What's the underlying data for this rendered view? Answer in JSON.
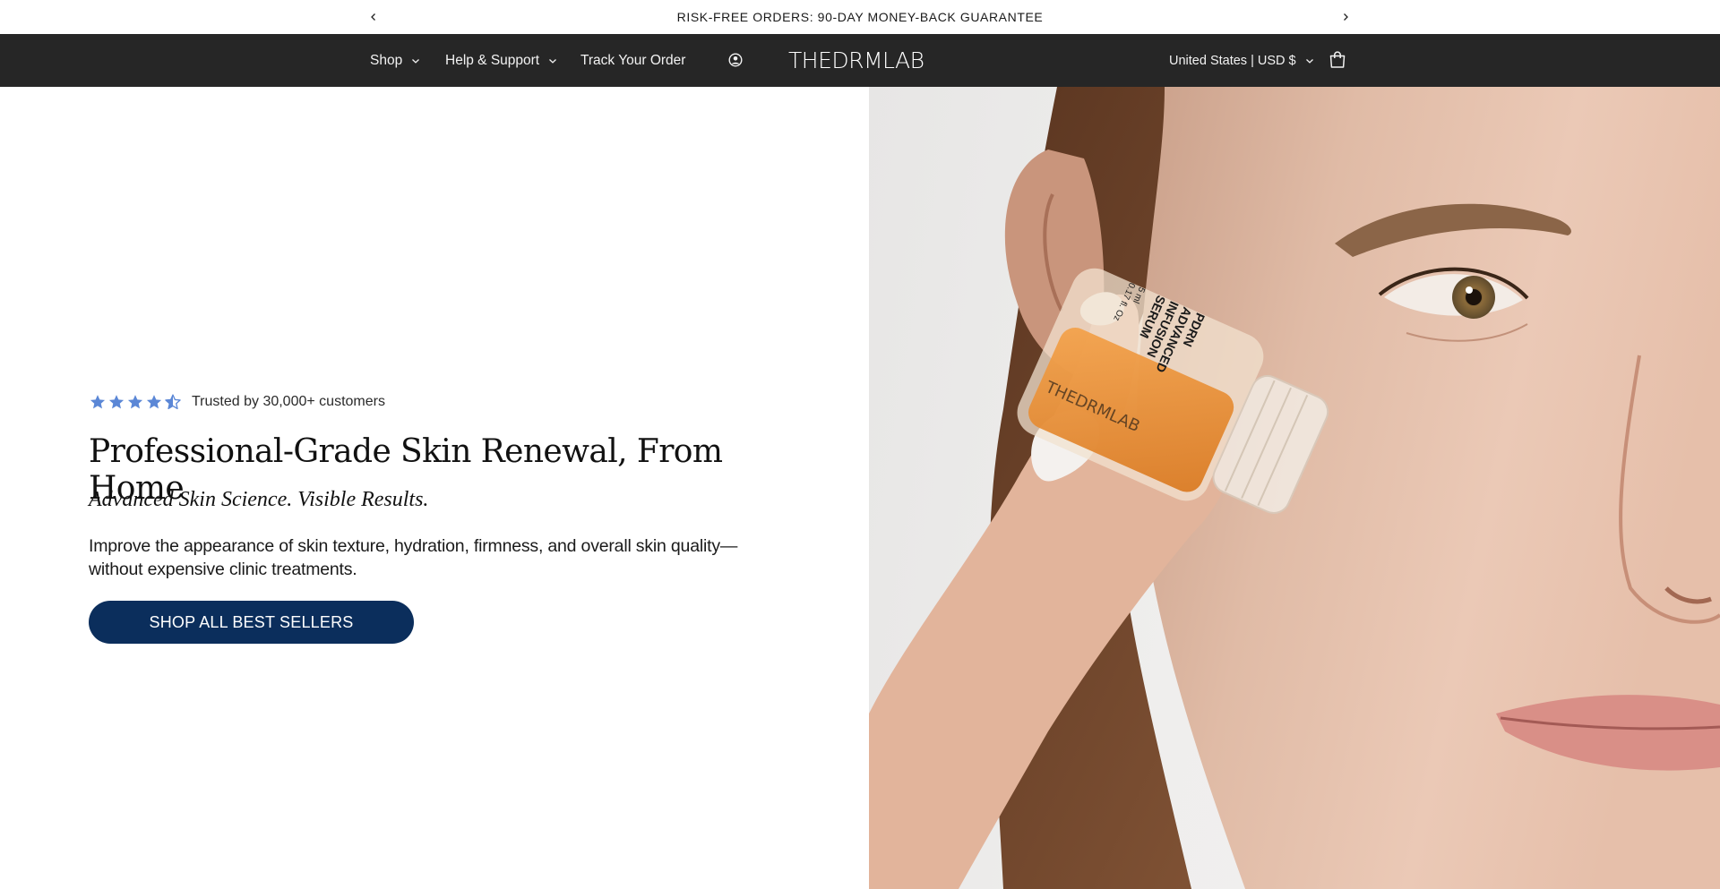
{
  "announcement": {
    "text": "RISK-FREE ORDERS: 90-DAY MONEY-BACK GUARANTEE",
    "prev_icon": "chevron-left-icon",
    "next_icon": "chevron-right-icon"
  },
  "header": {
    "nav": {
      "shop": "Shop",
      "help": "Help & Support",
      "track": "Track Your Order"
    },
    "account_icon": "account-icon",
    "logo": "THEDRMLAB",
    "locale": "United States | USD $",
    "cart_icon": "cart-icon",
    "background": "#262626"
  },
  "hero": {
    "rating": {
      "stars": 4.5,
      "star_color": "#5b87d6",
      "text": "Trusted by 30,000+ customers"
    },
    "title": "Professional-Grade Skin Renewal, From Home",
    "subtitle": "Advanced Skin Science. Visible Results.",
    "body": "Improve the appearance of skin texture, hydration, firmness, and overall skin quality—without expensive clinic treatments.",
    "cta": "SHOP ALL BEST SELLERS",
    "cta_color": "#0b2e5c",
    "image": {
      "bottle_label_lines": [
        "PDRN",
        "ADVANCED",
        "INFUSION",
        "SERUM"
      ],
      "bottle_volume": "5 ml",
      "bottle_volume_oz": "0.17 fl. Oz",
      "bottle_brand": "THEDRMLAB"
    }
  }
}
